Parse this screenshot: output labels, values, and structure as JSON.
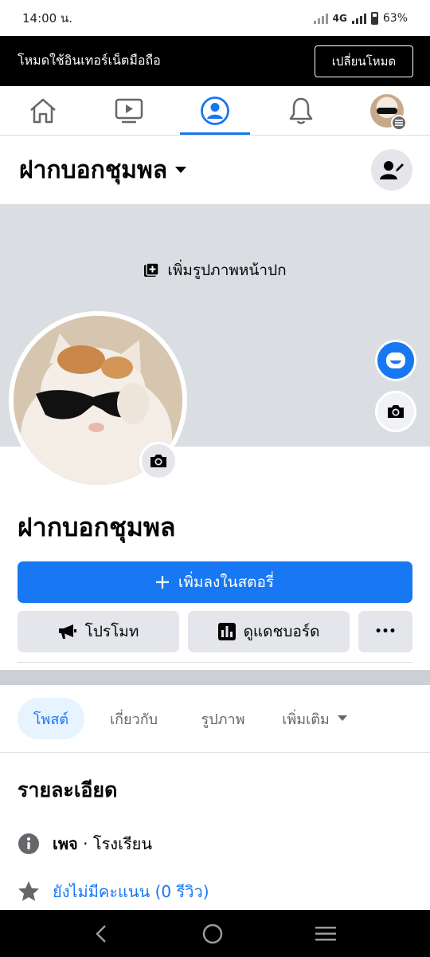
{
  "status_bar": {
    "time": "14:00 น.",
    "network": "4G",
    "battery": "63%"
  },
  "mode_banner": {
    "text": "โหมดใช้อินเทอร์เน็ตมือถือ",
    "button": "เปลี่ยนโหมด"
  },
  "nav": {
    "items": [
      {
        "icon": "home-icon"
      },
      {
        "icon": "watch-icon"
      },
      {
        "icon": "profile-icon",
        "active": true
      },
      {
        "icon": "bell-icon"
      },
      {
        "icon": "menu-avatar"
      }
    ]
  },
  "header": {
    "page_name": "ฝากบอกชุมพล"
  },
  "cover": {
    "add_cover_label": "เพิ่มรูปภาพหน้าปก"
  },
  "profile": {
    "name": "ฝากบอกชุมพล"
  },
  "actions": {
    "add_story": "เพิ่มลงในสตอรี่",
    "promote": "โปรโมท",
    "dashboard": "ดูแดชบอร์ด",
    "more": "•••"
  },
  "tabs": [
    {
      "label": "โพสต์",
      "active": true
    },
    {
      "label": "เกี่ยวกับ"
    },
    {
      "label": "รูปภาพ"
    },
    {
      "label": "เพิ่มเติม"
    }
  ],
  "details": {
    "title": "รายละเอียด",
    "page_label": "เพจ",
    "category": "· โรงเรียน",
    "rating": "ยังไม่มีคะแนน (0 รีวิว)"
  },
  "colors": {
    "accent": "#1877f2",
    "cover": "#dadde1",
    "button_gray": "#e4e6eb"
  }
}
